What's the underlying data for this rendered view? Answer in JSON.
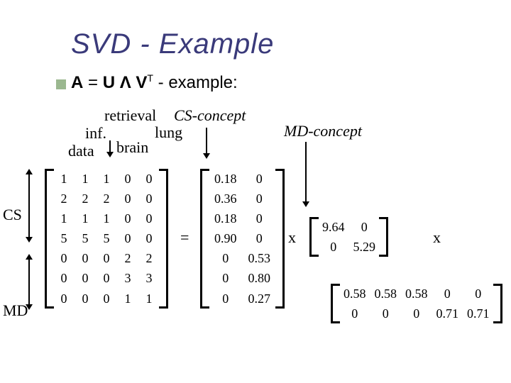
{
  "title": "SVD - Example",
  "equation": {
    "A": "A",
    "U": "U",
    "Lambda": "Λ",
    "V": "V",
    "T": "T",
    "tail": " - example:"
  },
  "cols": [
    "retrieval",
    "inf.",
    "data",
    "brain",
    "lung"
  ],
  "concepts": {
    "cs": "CS-concept",
    "md": "MD-concept"
  },
  "rowgroups": {
    "cs": "CS",
    "md": "MD"
  },
  "ops": {
    "eq": "=",
    "x": "x"
  },
  "matrices": {
    "A": [
      [
        1,
        1,
        1,
        0,
        0
      ],
      [
        2,
        2,
        2,
        0,
        0
      ],
      [
        1,
        1,
        1,
        0,
        0
      ],
      [
        5,
        5,
        5,
        0,
        0
      ],
      [
        0,
        0,
        0,
        2,
        2
      ],
      [
        0,
        0,
        0,
        3,
        3
      ],
      [
        0,
        0,
        0,
        1,
        1
      ]
    ],
    "U": [
      [
        "0.18",
        "0"
      ],
      [
        "0.36",
        "0"
      ],
      [
        "0.18",
        "0"
      ],
      [
        "0.90",
        "0"
      ],
      [
        "0",
        "0.53"
      ],
      [
        "0",
        "0.80"
      ],
      [
        "0",
        "0.27"
      ]
    ],
    "S": [
      [
        "9.64",
        "0"
      ],
      [
        "0",
        "5.29"
      ]
    ],
    "Vt": [
      [
        "0.58",
        "0.58",
        "0.58",
        "0",
        "0"
      ],
      [
        "0",
        "0",
        "0",
        "0.71",
        "0.71"
      ]
    ]
  }
}
